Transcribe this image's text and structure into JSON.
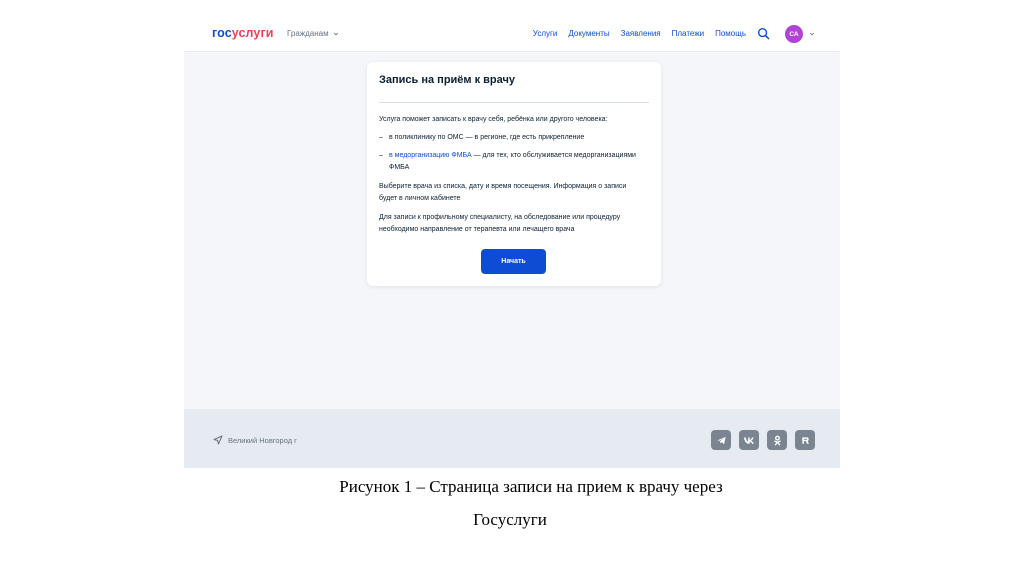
{
  "header": {
    "logo_part1": "гос",
    "logo_part2": "услуги",
    "citizens_label": "Гражданам",
    "nav": [
      "Услуги",
      "Документы",
      "Заявления",
      "Платежи",
      "Помощь"
    ],
    "avatar_initials": "СА"
  },
  "card": {
    "title": "Запись на приём к врачу",
    "intro": "Услуга поможет записать к врачу себя, ребёнка или другого человека:",
    "bullet1": "в поликлинику по ОМС — в регионе, где есть прикрепление",
    "bullet2_link": "в медорганизацию ФМБА",
    "bullet2_rest": " — для тех, кто обслуживается медорганизациями ФМБА",
    "info": "Выберите врача из списка, дату и время посещения. Информация о записи будет в личном кабинете",
    "referral": "Для записи к профильному специалисту, на обследование или процедуру необходимо направление от терапевта или лечащего врача",
    "start_button": "Начать"
  },
  "footer": {
    "location": "Великий Новгород г",
    "social": [
      "telegram-icon",
      "vk-icon",
      "ok-icon",
      "rutube-icon"
    ]
  },
  "caption": {
    "line1": "Рисунок 1 – Страница записи на прием к врачу через",
    "line2": "Госуслуги"
  },
  "colors": {
    "brand_blue": "#0d4cd3",
    "brand_red": "#ee3f58",
    "avatar": "#b144d8"
  }
}
